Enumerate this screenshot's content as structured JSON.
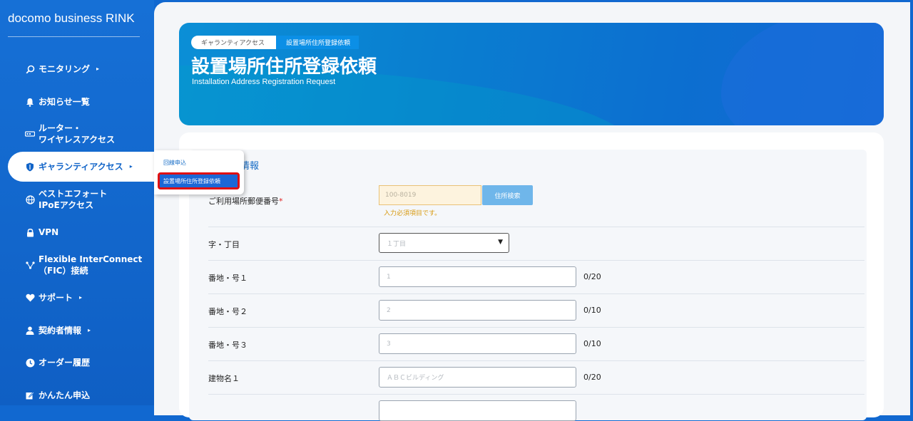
{
  "sidebar": {
    "brand": "docomo business RINK",
    "items": [
      {
        "label": "モニタリング",
        "icon": "search-icon",
        "caret": "▸"
      },
      {
        "label": "お知らせ一覧",
        "icon": "bell-icon"
      },
      {
        "label": "ルーター・\nワイヤレスアクセス",
        "icon": "router-icon"
      },
      {
        "label": "ギャランティアクセス",
        "icon": "shield-icon",
        "caret": "▸"
      },
      {
        "label": "ベストエフォート\nIPoEアクセス",
        "icon": "globe-icon"
      },
      {
        "label": "VPN",
        "icon": "lock-icon"
      },
      {
        "label": "Flexible InterConnect\n（FIC）接続",
        "icon": "network-icon"
      },
      {
        "label": "サポート",
        "icon": "support-icon",
        "caret": "▸"
      },
      {
        "label": "契約者情報",
        "icon": "user-icon",
        "caret": "▸"
      },
      {
        "label": "オーダー履歴",
        "icon": "clock-icon"
      },
      {
        "label": "かんたん申込",
        "icon": "edit-icon"
      }
    ]
  },
  "popup": {
    "item1": "回線申込",
    "item2": "設置場所住所登録依頼"
  },
  "hero": {
    "crumb1": "ギャランティアクセス",
    "crumb2": "設置場所住所登録依頼",
    "title": "設置場所住所登録依頼",
    "subtitle": "Installation Address Registration Request"
  },
  "form": {
    "section_title": "情報",
    "zip": {
      "label": "ご利用場所郵便番号",
      "required": "*",
      "placeholder": "100-8019",
      "button": "住所検索",
      "error": "入力必須項目です。"
    },
    "aza": {
      "label": "字・丁目",
      "placeholder": "１丁目",
      "caret": "▼"
    },
    "banchi1": {
      "label": "番地・号１",
      "placeholder": "1",
      "counter": "0/20"
    },
    "banchi2": {
      "label": "番地・号２",
      "placeholder": "2",
      "counter": "0/10"
    },
    "banchi3": {
      "label": "番地・号３",
      "placeholder": "3",
      "counter": "0/10"
    },
    "building1": {
      "label": "建物名１",
      "placeholder": "ＡＢＣビルディング",
      "counter": "0/20"
    }
  }
}
